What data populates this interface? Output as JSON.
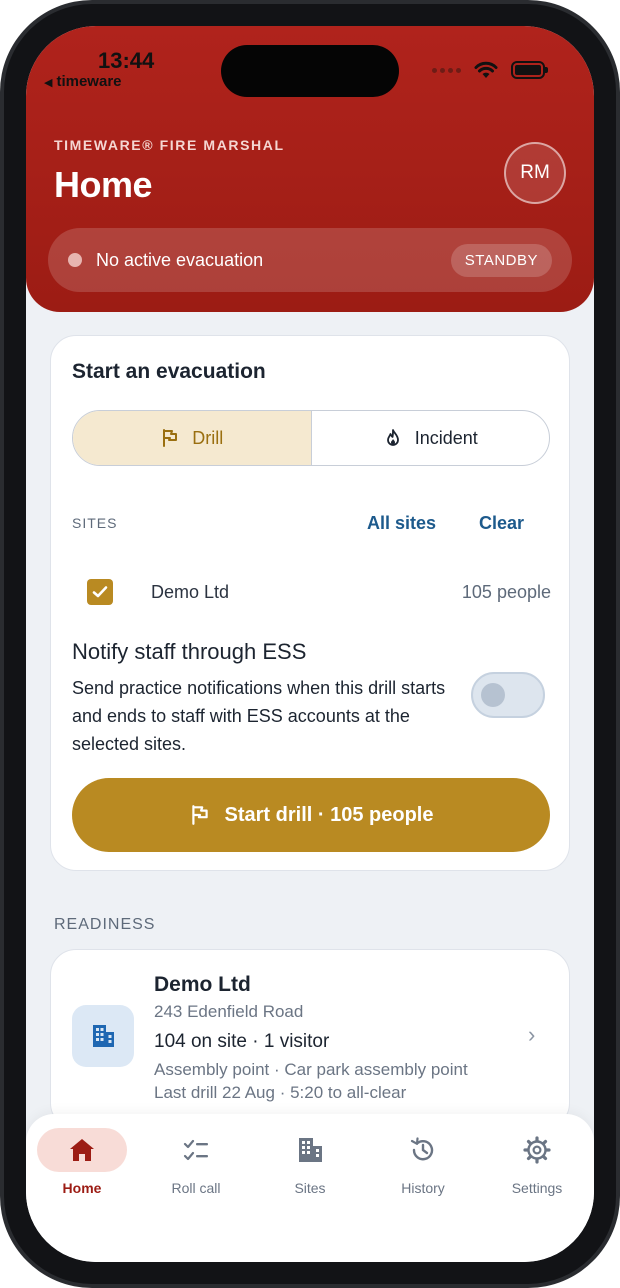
{
  "status_bar": {
    "time": "13:44",
    "back_app": "timeware"
  },
  "header": {
    "brand": "TIMEWARE® FIRE MARSHAL",
    "title": "Home",
    "avatar_initials": "RM",
    "evacuation_status": "No active evacuation",
    "status_badge": "STANDBY"
  },
  "start_card": {
    "title": "Start an evacuation",
    "mode_drill": "Drill",
    "mode_incident": "Incident",
    "sites_label": "SITES",
    "all_sites": "All sites",
    "clear": "Clear",
    "site": {
      "name": "Demo Ltd",
      "count": "105 people",
      "checked": true
    },
    "notify_title": "Notify staff through ESS",
    "notify_desc": "Send practice notifications when this drill starts and ends to staff with ESS accounts at the selected sites.",
    "notify_enabled": false,
    "start_button": "Start drill · 105 people"
  },
  "readiness": {
    "label": "READINESS",
    "site": {
      "name": "Demo Ltd",
      "address": "243 Edenfield Road",
      "on_site": "104 on site · 1 visitor",
      "assembly": "Assembly point · Car park assembly point",
      "last_drill": "Last drill 22 Aug · 5:20 to all-clear"
    }
  },
  "nav": {
    "home": "Home",
    "roll_call": "Roll call",
    "sites": "Sites",
    "history": "History",
    "settings": "Settings",
    "active": "home"
  },
  "colors": {
    "header_red": "#b0231c",
    "drill_gold": "#b98a22",
    "link_blue": "#1d5a8c",
    "nav_active": "#9c1c14"
  }
}
